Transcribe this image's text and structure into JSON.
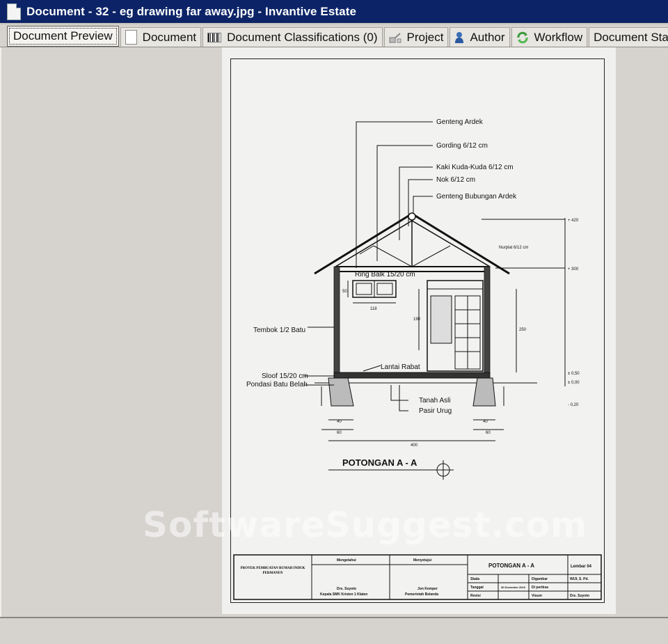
{
  "window": {
    "title": "Document - 32 - eg drawing far away.jpg - Invantive Estate"
  },
  "tabs": [
    {
      "label": "Document Preview",
      "icon": "none",
      "active": true
    },
    {
      "label": "Document",
      "icon": "document-icon"
    },
    {
      "label": "Document Classifications (0)",
      "icon": "barcode-icon"
    },
    {
      "label": "Project",
      "icon": "project-icon"
    },
    {
      "label": "Author",
      "icon": "author-icon"
    },
    {
      "label": "Workflow",
      "icon": "workflow-icon"
    },
    {
      "label": "Document Status",
      "icon": "none"
    }
  ],
  "drawing": {
    "labels": {
      "genteng_ardek": "Genteng Ardek",
      "gording": "Gording 6/12 cm",
      "kaki_kuda": "Kaki Kuda-Kuda 6/12 cm",
      "nok": "Nok 6/12 cm",
      "genteng_bubungan": "Genteng Bubungan Ardek",
      "ring_balk": "Ring Balk 15/20 cm",
      "tembok": "Tembok 1/2 Batu",
      "lantai": "Lantai Rabat",
      "sloof": "Sloof 15/20 cm",
      "pondasi": "Pondasi Batu Belah",
      "tanah": "Tanah Asli",
      "pasir": "Pasir Urug",
      "nurplat": "Nurplat 6/12 cm"
    },
    "dims": {
      "d50": "50",
      "d118": "118",
      "d190": "190",
      "d250": "250",
      "d40a": "40",
      "d40b": "40",
      "d60a": "60",
      "d60b": "60",
      "d400": "400"
    },
    "levels": {
      "l420": "+ 420",
      "l300": "+ 300",
      "l050": "± 0,50",
      "l000": "± 0,00",
      "lneg": "- 0,20"
    },
    "section_title": "POTONGAN A - A",
    "title_block": {
      "project": "PROYEK PEMBUATAN RUMAH INDUK PERMANEN",
      "checked_by_label": "Mengetahui",
      "checked_by_name": "Drs. Suyoto",
      "checked_by_role": "Kepala SMK Kristen 1 Klaten",
      "approved_label": "Menyetujui",
      "approved_name": "Jon Kemper",
      "approved_role": "Pemerintah Belanda",
      "sheet_title": "POTONGAN A - A",
      "sheet_no": "Lembar 04",
      "scale_label": "Skala",
      "date_label": "Tanggal",
      "date_value": "30 Desember 2016",
      "revision_label": "Revisi",
      "drawn_label": "Digambar",
      "drawn_value": "WIJI, S. Pd.",
      "checked_label": "Di periksa",
      "seen_label": "Visum",
      "seen_value": "Drs. Suyoto"
    }
  },
  "watermark": "SoftwareSuggest.com"
}
